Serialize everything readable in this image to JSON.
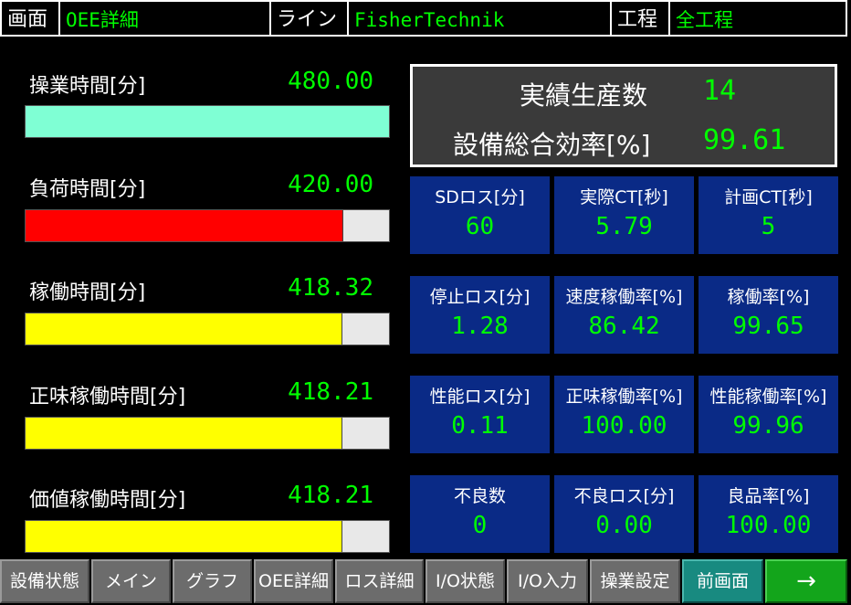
{
  "header": {
    "screen_label": "画面",
    "screen_value": "OEE詳細",
    "line_label": "ライン",
    "line_value": "FisherTechnik",
    "process_label": "工程",
    "process_value": "全工程"
  },
  "time_rows": [
    {
      "label": "操業時間[分]",
      "value": "480.00",
      "fill": 1.0,
      "color": "#7fffd4"
    },
    {
      "label": "負荷時間[分]",
      "value": "420.00",
      "fill": 0.875,
      "color": "#ff0000"
    },
    {
      "label": "稼働時間[分]",
      "value": "418.32",
      "fill": 0.8715,
      "color": "#ffff00"
    },
    {
      "label": "正味稼働時間[分]",
      "value": "418.21",
      "fill": 0.8713,
      "color": "#ffff00"
    },
    {
      "label": "価値稼働時間[分]",
      "value": "418.21",
      "fill": 0.8713,
      "color": "#ffff00"
    }
  ],
  "summary": {
    "production_label": "実績生産数",
    "production_value": "14",
    "oee_label": "設備総合効率[%]",
    "oee_value": "99.61"
  },
  "tiles": [
    {
      "label": "SDロス[分]",
      "value": "60"
    },
    {
      "label": "実際CT[秒]",
      "value": "5.79"
    },
    {
      "label": "計画CT[秒]",
      "value": "5"
    },
    {
      "label": "停止ロス[分]",
      "value": "1.28"
    },
    {
      "label": "速度稼働率[%]",
      "value": "86.42"
    },
    {
      "label": "稼働率[%]",
      "value": "99.65"
    },
    {
      "label": "性能ロス[分]",
      "value": "0.11"
    },
    {
      "label": "正味稼働率[%]",
      "value": "100.00"
    },
    {
      "label": "性能稼働率[%]",
      "value": "99.96"
    },
    {
      "label": "不良数",
      "value": "0"
    },
    {
      "label": "不良ロス[分]",
      "value": "0.00"
    },
    {
      "label": "良品率[%]",
      "value": "100.00"
    }
  ],
  "footer": [
    {
      "label": "設備状態"
    },
    {
      "label": "メイン"
    },
    {
      "label": "グラフ"
    },
    {
      "label": "OEE詳細"
    },
    {
      "label": "ロス詳細"
    },
    {
      "label": "I/O状態"
    },
    {
      "label": "I/O入力"
    },
    {
      "label": "操業設定"
    },
    {
      "label": "前画面"
    },
    {
      "label": "→"
    }
  ],
  "colors": {
    "value_green": "#00ff00",
    "tile_blue": "#0a2a86",
    "footer_gray": "#6c6c6c",
    "footer_active": "#188a80",
    "footer_next": "#13a51b"
  }
}
